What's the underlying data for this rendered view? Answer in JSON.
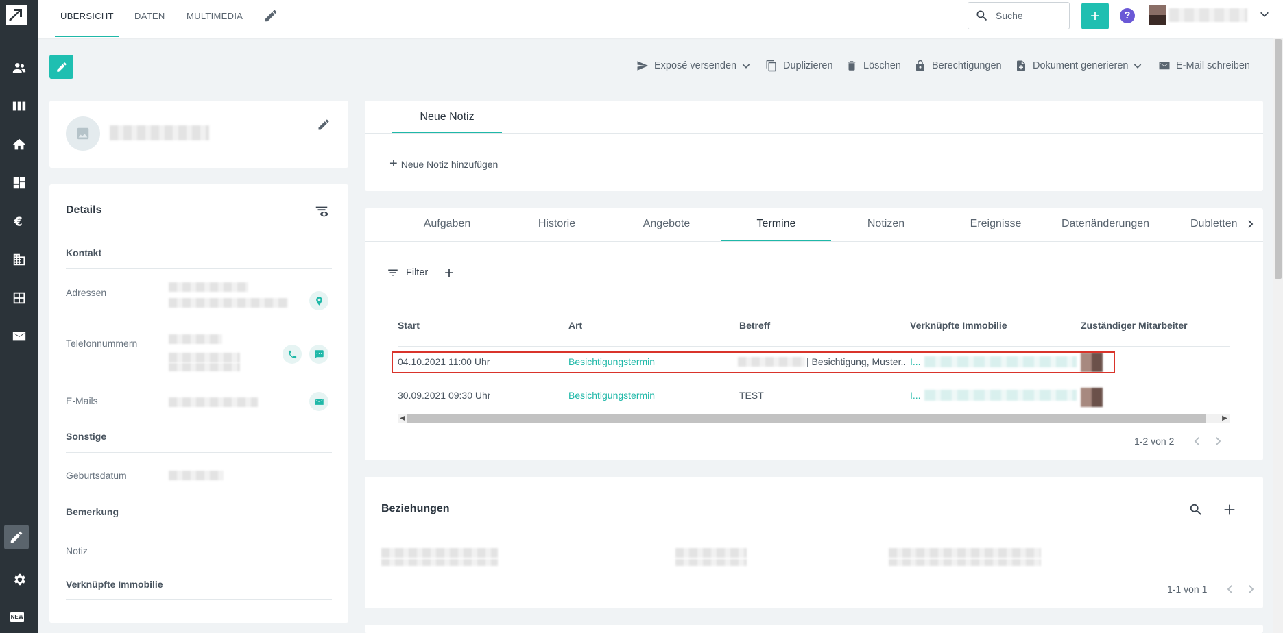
{
  "nav": {
    "tabs": [
      {
        "label": "ÜBERSICHT"
      },
      {
        "label": "DATEN"
      },
      {
        "label": "MULTIMEDIA"
      }
    ],
    "search_placeholder": "Suche",
    "plus": "+",
    "help": "?"
  },
  "rail": {
    "new_badge": "NEW"
  },
  "actions": [
    {
      "label": "Exposé versenden"
    },
    {
      "label": "Duplizieren"
    },
    {
      "label": "Löschen"
    },
    {
      "label": "Berechtigungen"
    },
    {
      "label": "Dokument generieren"
    },
    {
      "label": "E-Mail schreiben"
    }
  ],
  "details": {
    "title": "Details",
    "kontakt": "Kontakt",
    "adressen": "Adressen",
    "telefon": "Telefonnummern",
    "emails": "E-Mails",
    "sonstige": "Sonstige",
    "geburtsdatum": "Geburtsdatum",
    "bemerkung": "Bemerkung",
    "notiz": "Notiz",
    "immobilie": "Verknüpfte Immobilie"
  },
  "notes": {
    "tab": "Neue Notiz",
    "add": "Neue Notiz hinzufügen"
  },
  "tabs": [
    {
      "label": "Aufgaben"
    },
    {
      "label": "Historie"
    },
    {
      "label": "Angebote"
    },
    {
      "label": "Termine"
    },
    {
      "label": "Notizen"
    },
    {
      "label": "Ereignisse"
    },
    {
      "label": "Datenänderungen"
    },
    {
      "label": "Dubletten"
    }
  ],
  "termine": {
    "filter": "Filter",
    "columns": [
      "Start",
      "Art",
      "Betreff",
      "Verknüpfte Immobilie",
      "Zuständiger Mitarbeiter"
    ],
    "rows": [
      {
        "start": "04.10.2021 11:00 Uhr",
        "art": "Besichtigungstermin",
        "betreff": "| Besichtigung, Muster...",
        "immobilie": "I..."
      },
      {
        "start": "30.09.2021 09:30 Uhr",
        "art": "Besichtigungstermin",
        "betreff": "TEST",
        "immobilie": "I..."
      }
    ],
    "pager": "1-2 von 2"
  },
  "beziehungen": {
    "title": "Beziehungen",
    "pager": "1-1 von 1"
  },
  "colors": {
    "accent": "#1fb8a8",
    "rail": "#2b3339",
    "highlight": "#d9342b",
    "help": "#6a58d6"
  }
}
